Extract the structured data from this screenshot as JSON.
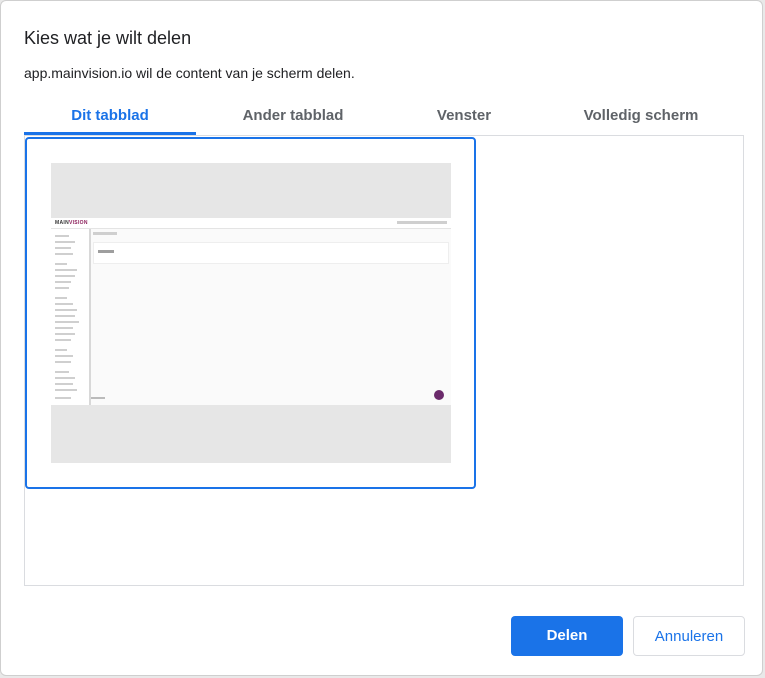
{
  "dialog": {
    "title": "Kies wat je wilt delen",
    "subtitle": "app.mainvision.io wil de content van je scherm delen."
  },
  "tabs": [
    {
      "label": "Dit tabblad",
      "active": true
    },
    {
      "label": "Ander tabblad",
      "active": false
    },
    {
      "label": "Venster",
      "active": false
    },
    {
      "label": "Volledig scherm",
      "active": false
    }
  ],
  "preview": {
    "logo_prefix": "MAIN",
    "logo_suffix": "VISION"
  },
  "buttons": {
    "share": "Delen",
    "cancel": "Annuleren"
  },
  "colors": {
    "accent": "#1a73e8",
    "brand": "#8b1e5a"
  }
}
